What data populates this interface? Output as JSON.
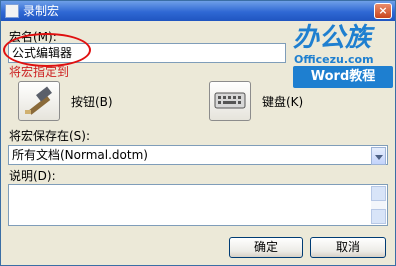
{
  "window": {
    "title": "录制宏",
    "close_glyph": "×",
    "icons": {
      "app": "app-icon",
      "close": "close-icon"
    }
  },
  "macro_name": {
    "label": "宏名(M):",
    "value": "公式编辑器"
  },
  "assign": {
    "label": "将宏指定到",
    "button": {
      "label": "按钮(B)",
      "icon": "hammer-icon"
    },
    "keyboard": {
      "label": "键盘(K)",
      "icon": "keyboard-icon"
    }
  },
  "store_in": {
    "label": "将宏保存在(S):",
    "value": "所有文档(Normal.dotm)",
    "icon": "dropdown-arrow-icon"
  },
  "description": {
    "label": "说明(D):",
    "value": ""
  },
  "buttons": {
    "ok": "确定",
    "cancel": "取消"
  },
  "watermark": {
    "brand": "办公族",
    "site": "Officezu.com",
    "tag": "Word教程"
  },
  "colors": {
    "title_bar": "#2f68d4",
    "dialog_bg": "#ece9d8",
    "annotation_red": "#e01010",
    "assign_label": "#cc2222",
    "watermark_blue": "#1e7fd0"
  }
}
